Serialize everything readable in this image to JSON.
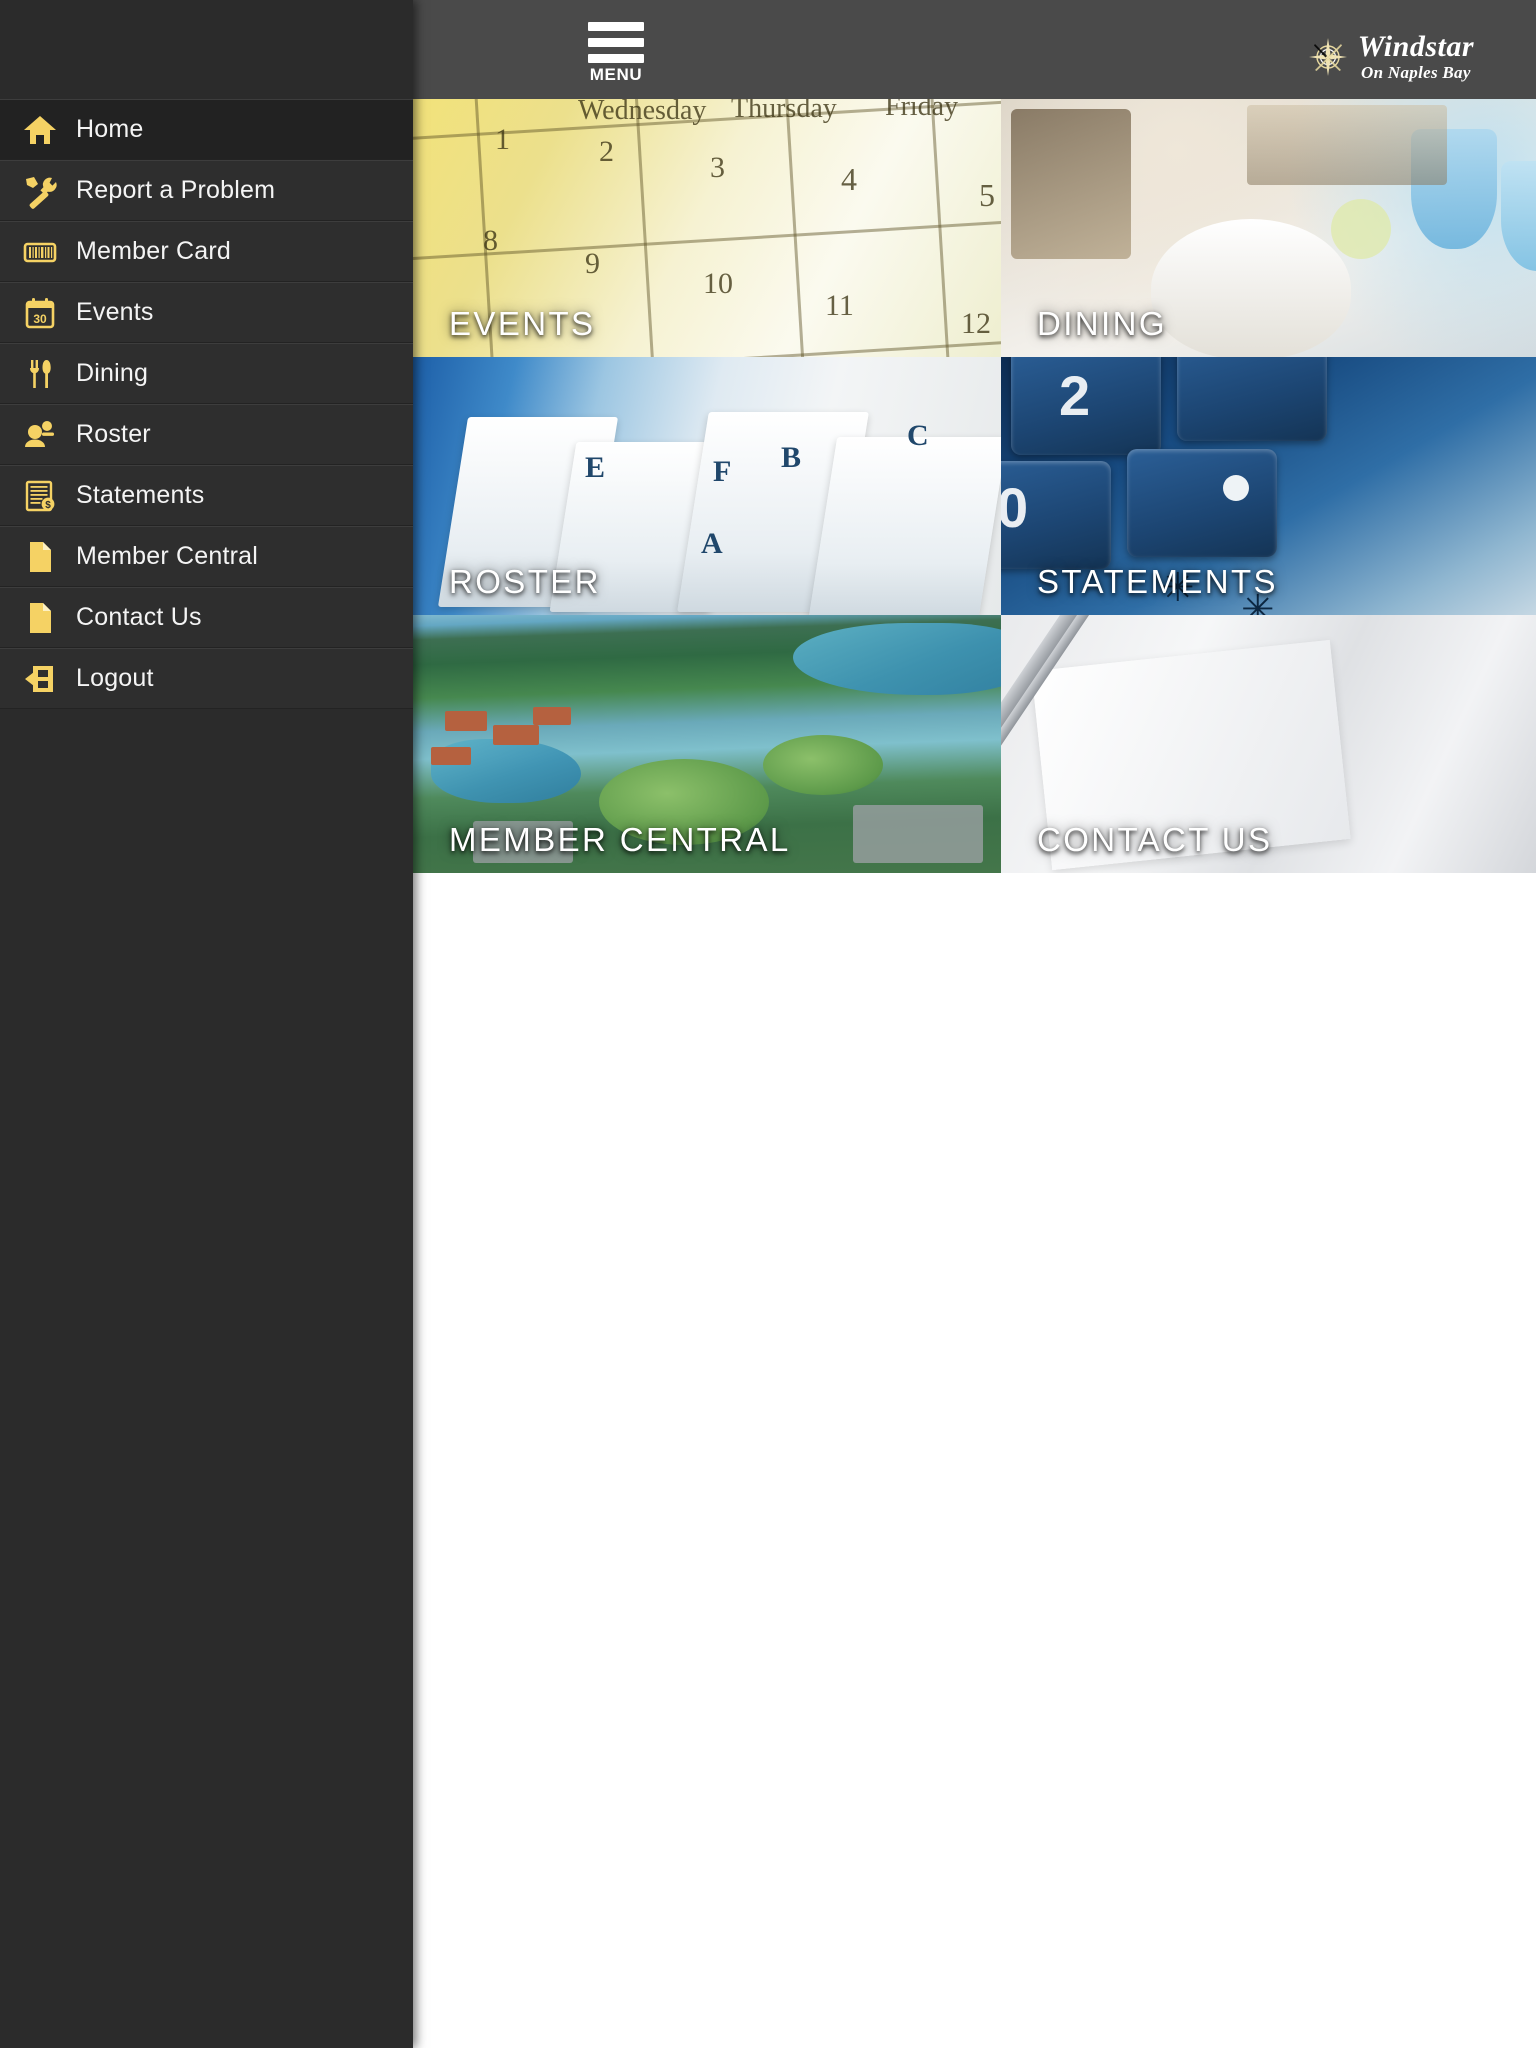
{
  "header": {
    "menu_button_label": "MENU",
    "menu_icon": "hamburger-icon",
    "brand_name": "Windstar",
    "brand_subtitle": "On Naples Bay",
    "brand_logo_icon": "compass-rose-icon",
    "background_color": "#4a4a4a"
  },
  "sidebar": {
    "background_color": "#2e2e2e",
    "accent_color": "#f5d264",
    "text_color": "#f4f4f4",
    "items": [
      {
        "label": "Home",
        "icon": "home-icon",
        "active": true
      },
      {
        "label": "Report a Problem",
        "icon": "tools-icon",
        "active": false
      },
      {
        "label": "Member Card",
        "icon": "barcode-icon",
        "active": false
      },
      {
        "label": "Events",
        "icon": "calendar-icon",
        "active": false
      },
      {
        "label": "Dining",
        "icon": "cutlery-icon",
        "active": false
      },
      {
        "label": "Roster",
        "icon": "people-icon",
        "active": false
      },
      {
        "label": "Statements",
        "icon": "invoice-icon",
        "active": false
      },
      {
        "label": "Member Central",
        "icon": "document-icon",
        "active": false
      },
      {
        "label": "Contact Us",
        "icon": "document-icon",
        "active": false
      },
      {
        "label": "Logout",
        "icon": "logout-arrow-icon",
        "active": false
      }
    ]
  },
  "main": {
    "tiles": [
      {
        "label": "EVENTS",
        "art": "calendar-photo"
      },
      {
        "label": "DINING",
        "art": "table-setting-photo"
      },
      {
        "label": "ROSTER",
        "art": "file-folders-photo"
      },
      {
        "label": "STATEMENTS",
        "art": "calculator-photo"
      },
      {
        "label": "MEMBER CENTRAL",
        "art": "aerial-golf-community-photo"
      },
      {
        "label": "CONTACT US",
        "art": "paper-and-pen-photo"
      }
    ]
  },
  "art_text": {
    "calendar_days": [
      "Wednesday",
      "Thursday",
      "Friday"
    ],
    "calendar_numbers": [
      "1",
      "2",
      "3",
      "4",
      "5",
      "8",
      "9",
      "10",
      "11",
      "12"
    ],
    "folder_letters": [
      "E",
      "B",
      "C",
      "A",
      "F"
    ],
    "calculator_digits": [
      "2",
      "0"
    ]
  }
}
